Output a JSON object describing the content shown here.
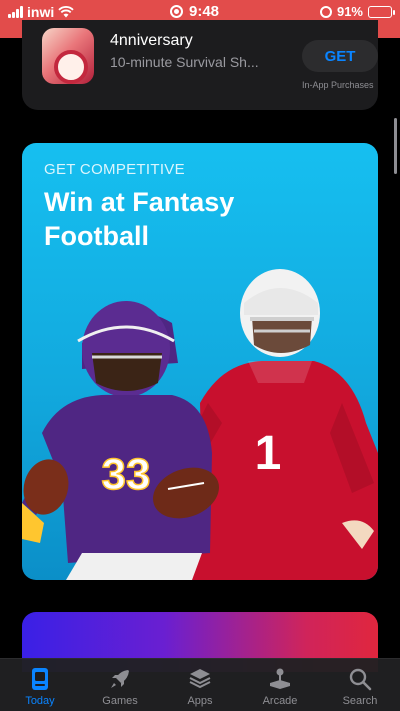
{
  "status_bar": {
    "carrier": "inwi",
    "time": "9:48",
    "battery": "91%",
    "battery_level": 0.91
  },
  "previous_card": {
    "app_name": "4nniversary",
    "subtitle": "10-minute Survival Sh...",
    "get_label": "GET",
    "iap_note": "In-App Purchases"
  },
  "feature_card": {
    "eyebrow": "GET COMPETITIVE",
    "headline": "Win at Fantasy Football",
    "jersey_left": "33",
    "jersey_right": "1"
  },
  "tab_bar": {
    "tabs": [
      {
        "label": "Today",
        "icon": "today-icon",
        "active": true
      },
      {
        "label": "Games",
        "icon": "rocket-icon",
        "active": false
      },
      {
        "label": "Apps",
        "icon": "apps-stack-icon",
        "active": false
      },
      {
        "label": "Arcade",
        "icon": "joystick-icon",
        "active": false
      },
      {
        "label": "Search",
        "icon": "search-icon",
        "active": false
      }
    ]
  },
  "colors": {
    "status_bar_bg": "#e24c4b",
    "accent": "#0a84ff",
    "card_blue": "#16bff0",
    "tab_inactive": "#8e8e93"
  }
}
